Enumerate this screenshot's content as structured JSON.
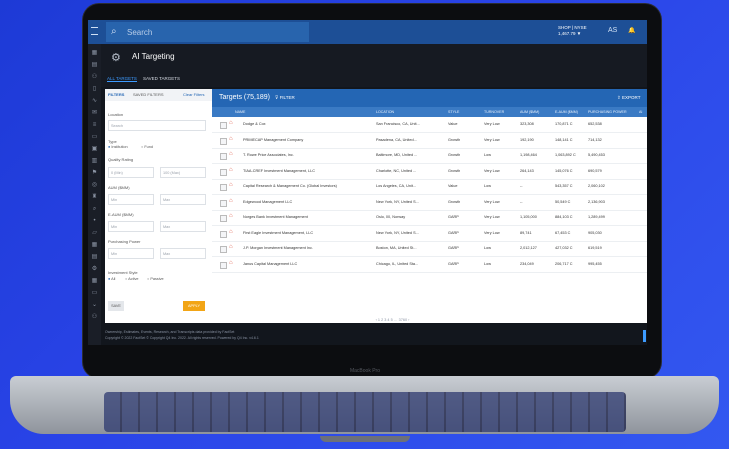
{
  "device": {
    "model": "MacBook Pro"
  },
  "topbar": {
    "search_placeholder": "Search",
    "ticker_line1": "SHOP | NYSE",
    "ticker_line2": "1,467.79 ▼",
    "icon_user": "AS",
    "icon_notify": "🔔"
  },
  "header": {
    "title": "AI Targeting"
  },
  "tabs": [
    {
      "label": "ALL TARGETS",
      "active": true
    },
    {
      "label": "SAVED TARGETS",
      "active": false
    }
  ],
  "filters": {
    "tab_filters": "FILTERS",
    "tab_saved": "SAVED FILTERS",
    "clear": "Clear Filters",
    "location_label": "Location",
    "location_placeholder": "Search",
    "type_label": "Type",
    "type_institution": "Institution",
    "type_fund": "Fund",
    "quality_label": "Quality Rating",
    "quality_min": "0 (Min)",
    "quality_max": "100 (Max)",
    "aum_label": "AUM ($MM)",
    "aum_min": "Min",
    "aum_max": "Max",
    "eaum_label": "E-AUM ($MM)",
    "eaum_min": "Min",
    "eaum_max": "Max",
    "pp_label": "Purchasing Power",
    "pp_min": "Min",
    "pp_max": "Max",
    "style_label": "Investment Style",
    "style_all": "All",
    "style_active": "Active",
    "style_passive": "Passive",
    "save": "SAVE",
    "apply": "APPLY"
  },
  "results": {
    "title": "Targets (75,189)",
    "filter_btn": "FILTER",
    "export_btn": "EXPORT",
    "columns": [
      "NAME",
      "LOCATION",
      "STYLE",
      "TURNOVER",
      "AUM ($MM)",
      "E-AUM ($MM)",
      "PURCHASING POWER",
      "AI"
    ],
    "rows": [
      {
        "name": "Dodge & Cox",
        "location": "San Francisco, CA, Unit...",
        "style": "Value",
        "turnover": "Very Low",
        "aum": "323,308",
        "eaum": "170,871 C",
        "pp": "652,538"
      },
      {
        "name": "PRIMECAP Management Company",
        "location": "Pasadena, CA, United...",
        "style": "Growth",
        "turnover": "Very Low",
        "aum": "192,190",
        "eaum": "148,141 C",
        "pp": "714,132"
      },
      {
        "name": "T. Rowe Price Associates, Inc.",
        "location": "Baltimore, MD, United ...",
        "style": "Growth",
        "turnover": "Low",
        "aum": "1,198,464",
        "eaum": "1,063,892 C",
        "pp": "5,490,453"
      },
      {
        "name": "TIAA-CREF Investment Management, LLC",
        "location": "Charlotte, NC, United ...",
        "style": "Growth",
        "turnover": "Very Low",
        "aum": "264,143",
        "eaum": "145,076 C",
        "pp": "690,579"
      },
      {
        "name": "Capital Research & Management Co. (Global Investors)",
        "location": "Los Angeles, CA, Unit...",
        "style": "Value",
        "turnover": "Low",
        "aum": "--",
        "eaum": "543,357 C",
        "pp": "2,060,102"
      },
      {
        "name": "Edgewood Management LLC",
        "location": "New York, NY, United S...",
        "style": "Growth",
        "turnover": "Very Low",
        "aum": "--",
        "eaum": "50,549 C",
        "pp": "2,136,903"
      },
      {
        "name": "Norges Bank Investment Management",
        "location": "Oslo, 00, Norway",
        "style": "GARP",
        "turnover": "Very Low",
        "aum": "1,105,000",
        "eaum": "884,103 C",
        "pp": "1,289,499"
      },
      {
        "name": "First Eagle Investment Management, LLC",
        "location": "New York, NY, United S...",
        "style": "GARP",
        "turnover": "Very Low",
        "aum": "89,741",
        "eaum": "67,453 C",
        "pp": "905,030"
      },
      {
        "name": "J.P. Morgan Investment Management Inc.",
        "location": "Boston, MA, United St...",
        "style": "GARP",
        "turnover": "Low",
        "aum": "2,012,127",
        "eaum": "427,032 C",
        "pp": "619,519"
      },
      {
        "name": "Janus Capital Management LLC",
        "location": "Chicago, IL, United Sta...",
        "style": "GARP",
        "turnover": "Low",
        "aum": "234,049",
        "eaum": "206,717 C",
        "pp": "995,455"
      }
    ],
    "pager": "‹ 1 2 3 4 5 … 3760 ›"
  },
  "footer": {
    "line1": "Ownership, Estimates, Events, Research, and Transcripts data provided by FactSet",
    "line2": "Copyright © 2022 FactSet   © Copyright Q4 Inc. 2022. All rights reserved.   Powered by Q4 Inc. v4.6.1"
  }
}
